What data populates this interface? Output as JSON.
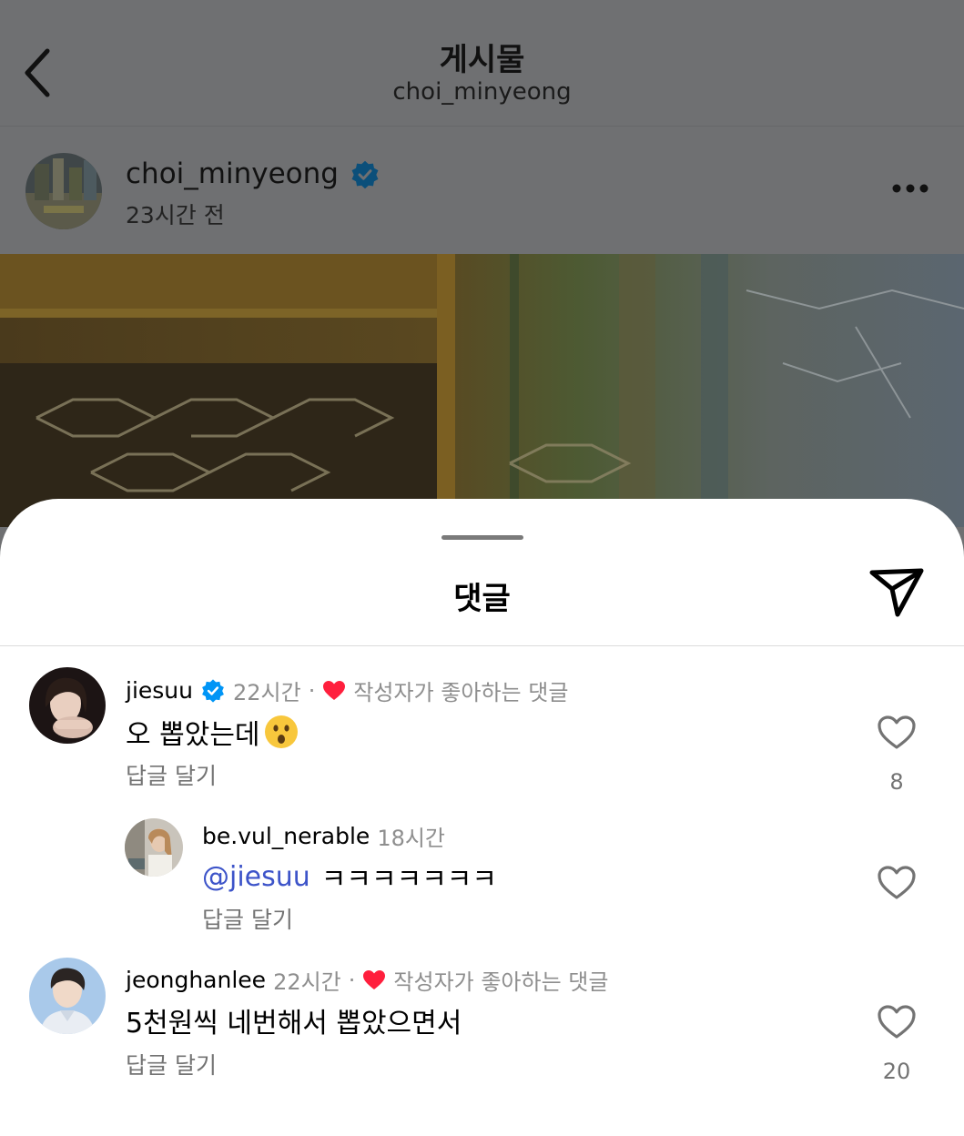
{
  "header": {
    "title": "게시물",
    "subtitle": "choi_minyeong"
  },
  "post": {
    "author": "choi_minyeong",
    "time": "23시간 전",
    "verified": true
  },
  "comments_sheet": {
    "title": "댓글",
    "comments": [
      {
        "username": "jiesuu",
        "verified": true,
        "time": "22시간",
        "separator": "·",
        "badge": "작성자가 좋아하는 댓글",
        "text": "오 뽑았는데",
        "emoji": "hushed-face",
        "reply_label": "답글 달기",
        "likes": "8"
      },
      {
        "username": "be.vul_nerable",
        "time": "18시간",
        "mention": "@jiesuu",
        "text": "ㅋㅋㅋㅋㅋㅋㅋ",
        "reply_label": "답글 달기"
      },
      {
        "username": "jeonghanlee",
        "time": "22시간",
        "separator": "·",
        "badge": "작성자가 좋아하는 댓글",
        "text": "5천원씩 네번해서 뽑았으면서",
        "reply_label": "답글 달기",
        "likes": "20"
      }
    ]
  },
  "colors": {
    "verified_blue": "#0095f6",
    "heart_red": "#ff1f3d",
    "mention_blue": "#3d54c9",
    "overlay_gray": "#6f7072"
  }
}
